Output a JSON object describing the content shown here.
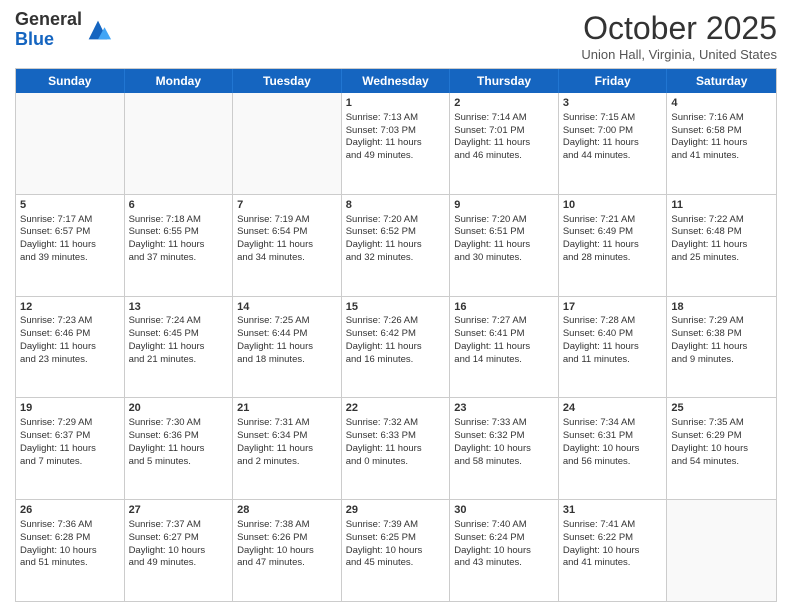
{
  "header": {
    "logo_general": "General",
    "logo_blue": "Blue",
    "month_title": "October 2025",
    "location": "Union Hall, Virginia, United States"
  },
  "days_of_week": [
    "Sunday",
    "Monday",
    "Tuesday",
    "Wednesday",
    "Thursday",
    "Friday",
    "Saturday"
  ],
  "weeks": [
    [
      {
        "day": "",
        "info": ""
      },
      {
        "day": "",
        "info": ""
      },
      {
        "day": "",
        "info": ""
      },
      {
        "day": "1",
        "info": "Sunrise: 7:13 AM\nSunset: 7:03 PM\nDaylight: 11 hours\nand 49 minutes."
      },
      {
        "day": "2",
        "info": "Sunrise: 7:14 AM\nSunset: 7:01 PM\nDaylight: 11 hours\nand 46 minutes."
      },
      {
        "day": "3",
        "info": "Sunrise: 7:15 AM\nSunset: 7:00 PM\nDaylight: 11 hours\nand 44 minutes."
      },
      {
        "day": "4",
        "info": "Sunrise: 7:16 AM\nSunset: 6:58 PM\nDaylight: 11 hours\nand 41 minutes."
      }
    ],
    [
      {
        "day": "5",
        "info": "Sunrise: 7:17 AM\nSunset: 6:57 PM\nDaylight: 11 hours\nand 39 minutes."
      },
      {
        "day": "6",
        "info": "Sunrise: 7:18 AM\nSunset: 6:55 PM\nDaylight: 11 hours\nand 37 minutes."
      },
      {
        "day": "7",
        "info": "Sunrise: 7:19 AM\nSunset: 6:54 PM\nDaylight: 11 hours\nand 34 minutes."
      },
      {
        "day": "8",
        "info": "Sunrise: 7:20 AM\nSunset: 6:52 PM\nDaylight: 11 hours\nand 32 minutes."
      },
      {
        "day": "9",
        "info": "Sunrise: 7:20 AM\nSunset: 6:51 PM\nDaylight: 11 hours\nand 30 minutes."
      },
      {
        "day": "10",
        "info": "Sunrise: 7:21 AM\nSunset: 6:49 PM\nDaylight: 11 hours\nand 28 minutes."
      },
      {
        "day": "11",
        "info": "Sunrise: 7:22 AM\nSunset: 6:48 PM\nDaylight: 11 hours\nand 25 minutes."
      }
    ],
    [
      {
        "day": "12",
        "info": "Sunrise: 7:23 AM\nSunset: 6:46 PM\nDaylight: 11 hours\nand 23 minutes."
      },
      {
        "day": "13",
        "info": "Sunrise: 7:24 AM\nSunset: 6:45 PM\nDaylight: 11 hours\nand 21 minutes."
      },
      {
        "day": "14",
        "info": "Sunrise: 7:25 AM\nSunset: 6:44 PM\nDaylight: 11 hours\nand 18 minutes."
      },
      {
        "day": "15",
        "info": "Sunrise: 7:26 AM\nSunset: 6:42 PM\nDaylight: 11 hours\nand 16 minutes."
      },
      {
        "day": "16",
        "info": "Sunrise: 7:27 AM\nSunset: 6:41 PM\nDaylight: 11 hours\nand 14 minutes."
      },
      {
        "day": "17",
        "info": "Sunrise: 7:28 AM\nSunset: 6:40 PM\nDaylight: 11 hours\nand 11 minutes."
      },
      {
        "day": "18",
        "info": "Sunrise: 7:29 AM\nSunset: 6:38 PM\nDaylight: 11 hours\nand 9 minutes."
      }
    ],
    [
      {
        "day": "19",
        "info": "Sunrise: 7:29 AM\nSunset: 6:37 PM\nDaylight: 11 hours\nand 7 minutes."
      },
      {
        "day": "20",
        "info": "Sunrise: 7:30 AM\nSunset: 6:36 PM\nDaylight: 11 hours\nand 5 minutes."
      },
      {
        "day": "21",
        "info": "Sunrise: 7:31 AM\nSunset: 6:34 PM\nDaylight: 11 hours\nand 2 minutes."
      },
      {
        "day": "22",
        "info": "Sunrise: 7:32 AM\nSunset: 6:33 PM\nDaylight: 11 hours\nand 0 minutes."
      },
      {
        "day": "23",
        "info": "Sunrise: 7:33 AM\nSunset: 6:32 PM\nDaylight: 10 hours\nand 58 minutes."
      },
      {
        "day": "24",
        "info": "Sunrise: 7:34 AM\nSunset: 6:31 PM\nDaylight: 10 hours\nand 56 minutes."
      },
      {
        "day": "25",
        "info": "Sunrise: 7:35 AM\nSunset: 6:29 PM\nDaylight: 10 hours\nand 54 minutes."
      }
    ],
    [
      {
        "day": "26",
        "info": "Sunrise: 7:36 AM\nSunset: 6:28 PM\nDaylight: 10 hours\nand 51 minutes."
      },
      {
        "day": "27",
        "info": "Sunrise: 7:37 AM\nSunset: 6:27 PM\nDaylight: 10 hours\nand 49 minutes."
      },
      {
        "day": "28",
        "info": "Sunrise: 7:38 AM\nSunset: 6:26 PM\nDaylight: 10 hours\nand 47 minutes."
      },
      {
        "day": "29",
        "info": "Sunrise: 7:39 AM\nSunset: 6:25 PM\nDaylight: 10 hours\nand 45 minutes."
      },
      {
        "day": "30",
        "info": "Sunrise: 7:40 AM\nSunset: 6:24 PM\nDaylight: 10 hours\nand 43 minutes."
      },
      {
        "day": "31",
        "info": "Sunrise: 7:41 AM\nSunset: 6:22 PM\nDaylight: 10 hours\nand 41 minutes."
      },
      {
        "day": "",
        "info": ""
      }
    ]
  ]
}
